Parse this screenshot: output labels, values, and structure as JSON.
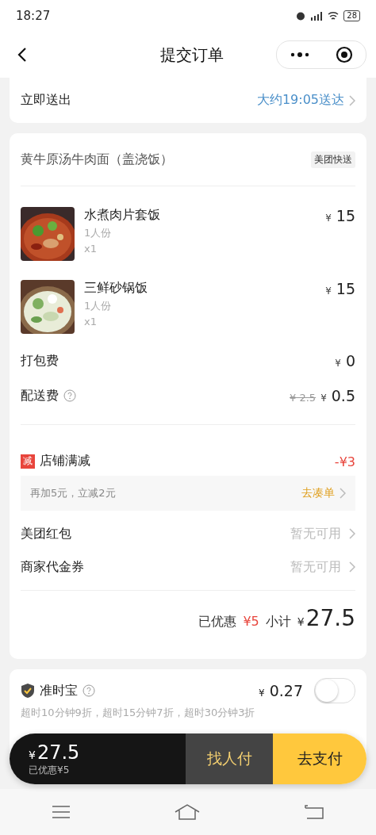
{
  "status_bar": {
    "time": "18:27",
    "battery": "28"
  },
  "nav": {
    "title": "提交订单"
  },
  "delivery": {
    "label": "立即送出",
    "eta": "大约19:05送达"
  },
  "order": {
    "shop": "黄牛原汤牛肉面（盖浇饭）",
    "badge": "美团快送",
    "items": [
      {
        "name": "水煮肉片套饭",
        "spec": "1人份",
        "qty": "x1",
        "currency": "¥",
        "price": "15"
      },
      {
        "name": "三鲜砂锅饭",
        "spec": "1人份",
        "qty": "x1",
        "currency": "¥",
        "price": "15"
      }
    ],
    "fees": [
      {
        "label": "打包费",
        "help": false,
        "currency": "¥",
        "price": "0"
      },
      {
        "label": "配送费",
        "help": true,
        "original": "¥ 2.5",
        "currency": "¥",
        "price": "0.5"
      }
    ],
    "promo": {
      "tag": "减",
      "label": "店铺满减",
      "amount": "-¥3",
      "hint": "再加5元，立减2元",
      "action": "去凑单"
    },
    "coupons": [
      {
        "label": "美团红包",
        "value": "暂无可用"
      },
      {
        "label": "商家代金券",
        "value": "暂无可用"
      }
    ],
    "summary": {
      "saved_label": "已优惠",
      "saved": "¥5",
      "subtotal_label": "小计",
      "currency": "¥",
      "subtotal": "27.5"
    }
  },
  "insurance": {
    "label": "准时宝",
    "currency": "¥",
    "price": "0.27",
    "on": false,
    "note": "超时10分钟9折，超时15分钟7折，超时30分钟3折"
  },
  "pay_bar": {
    "currency": "¥",
    "total": "27.5",
    "saved": "已优惠¥5",
    "others_pay": "找人付",
    "pay": "去支付"
  }
}
